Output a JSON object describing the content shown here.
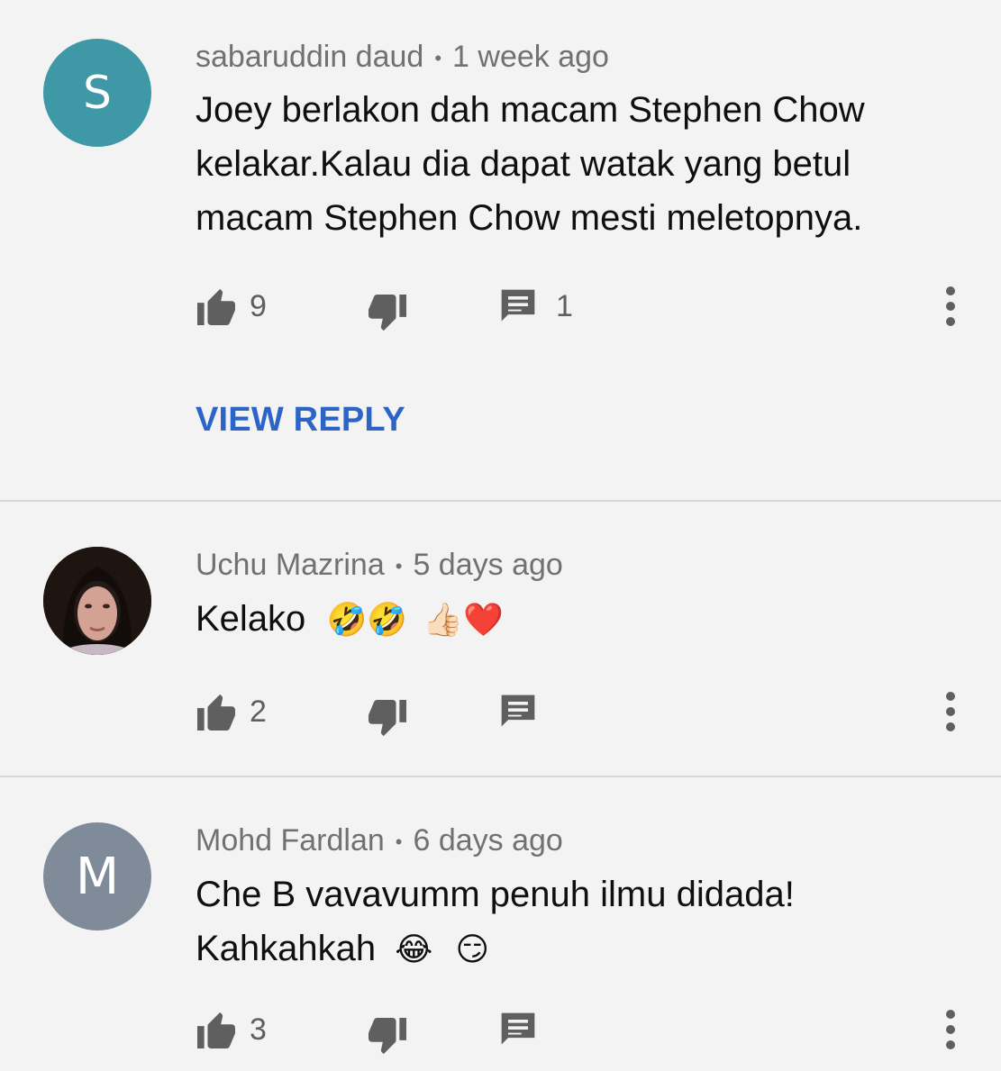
{
  "comments": [
    {
      "author": "sabaruddin daud",
      "time": "1 week ago",
      "avatar_initial": "S",
      "avatar_color": "#3f98a6",
      "text_lines": [
        "Joey berlakon dah macam Stephen Chow",
        "kelakar.Kalau dia dapat watak yang betul",
        "macam Stephen Chow mesti meletopnya."
      ],
      "likes": "9",
      "replies": "1",
      "view_reply": "VIEW REPLY"
    },
    {
      "author": "Uchu Mazrina",
      "time": "5 days ago",
      "avatar_initial": "",
      "avatar_color": "#2a1a14",
      "text": "Kelako",
      "emojis": [
        "🤣",
        "🤣",
        "👍🏻",
        "❤️"
      ],
      "likes": "2",
      "replies": ""
    },
    {
      "author": "Mohd Fardlan",
      "time": "6 days ago",
      "avatar_initial": "M",
      "avatar_color": "#808b9a",
      "text_line1": "Che B vavavumm penuh ilmu didada!",
      "text_line2": "Kahkahkah",
      "emojis": [
        "😂",
        "😏"
      ],
      "likes": "3",
      "replies": ""
    }
  ],
  "separator": "•",
  "icons": {
    "like": "thumbs-up-icon",
    "dislike": "thumbs-down-icon",
    "reply": "comment-icon",
    "more": "more-vertical-icon"
  },
  "colors": {
    "background": "#f3f3f3",
    "link": "#2d64c7",
    "meta": "#717171",
    "icon": "#5f5f5f"
  }
}
